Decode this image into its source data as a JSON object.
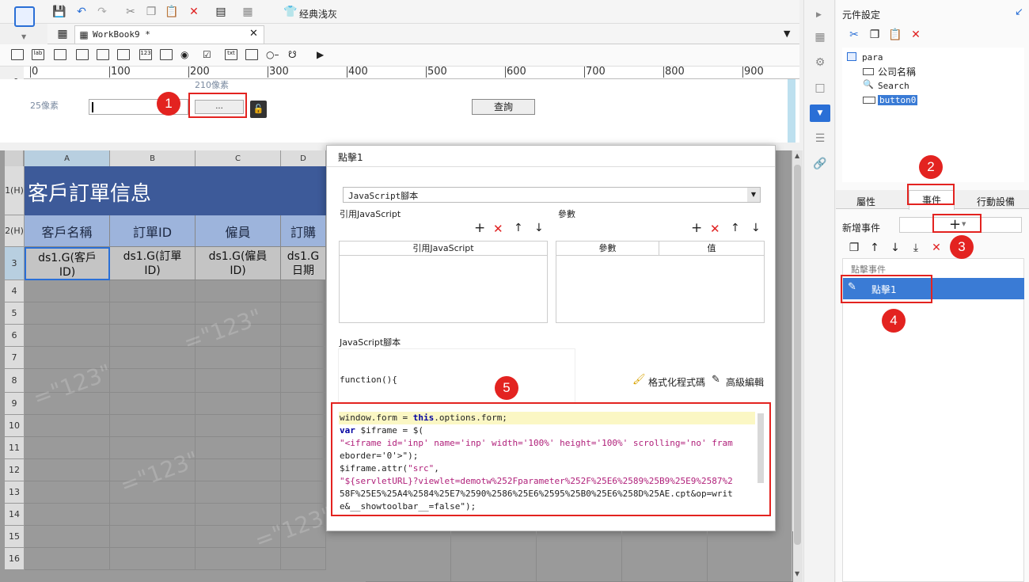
{
  "toolbar": {
    "theme_label": "经典浅灰"
  },
  "tab": {
    "title": "WorkBook9 *"
  },
  "ruler": {
    "ticks": [
      "0",
      "100",
      "200",
      "300",
      "400",
      "500",
      "600",
      "700",
      "800",
      "900"
    ],
    "left_ticks": [
      "0"
    ]
  },
  "param": {
    "width_label": "210像素",
    "height_label": "25像素",
    "button_text": "...",
    "query_button": "查詢"
  },
  "grid": {
    "columns": [
      "A",
      "B",
      "C",
      "D"
    ],
    "rows": [
      "1(H)",
      "2(H)",
      "3",
      "4",
      "5",
      "6",
      "7",
      "8",
      "9",
      "10",
      "11",
      "12",
      "13",
      "14",
      "15",
      "16"
    ],
    "title": "客戶訂單信息",
    "headers": [
      "客戶名稱",
      "訂單ID",
      "僱員",
      "訂購"
    ],
    "cells": [
      "ds1.G(客戶\nID)",
      "ds1.G(訂單\nID)",
      "ds1.G(僱員\nID)",
      "ds1.G\n日期"
    ],
    "watermark": "=\"123\""
  },
  "right_panel": {
    "title": "元件設定",
    "tree": {
      "root": "para",
      "items": [
        "公司名稱",
        "Search",
        "button0"
      ]
    },
    "tabs": [
      "屬性",
      "事件",
      "行動設備"
    ],
    "add_event_label": "新增事件",
    "event_group": "點擊事件",
    "event_item": "點擊1"
  },
  "dialog": {
    "title": "點擊1",
    "type_select": "JavaScript腳本",
    "ref_js_label": "引用JavaScript",
    "params_label": "參數",
    "ref_js_col": "引用JavaScript",
    "param_col": "參數",
    "value_col": "值",
    "script_label": "JavaScript腳本",
    "function_sig": "function(){",
    "format_label": "格式化程式碼",
    "advanced_label": "高級編輯",
    "code_lines": [
      "window.form = this.options.form;",
      "var $iframe = $(",
      "\"<iframe id='inp' name='inp' width='100%' height='100%' scrolling='no' fram",
      "eborder='0'>\");",
      "$iframe.attr(\"src\",",
      "\"${servletURL}?viewlet=demotw%252Fparameter%252F%25E6%2589%25B9%25E9%2587%2",
      "58F%25E5%25A4%2584%25E7%2590%2586%25E6%2595%25B0%25E6%258D%25AE.cpt&op=writ",
      "e&__showtoolbar__=false\");",
      "}"
    ]
  },
  "badges": [
    "1",
    "2",
    "3",
    "4",
    "5"
  ]
}
